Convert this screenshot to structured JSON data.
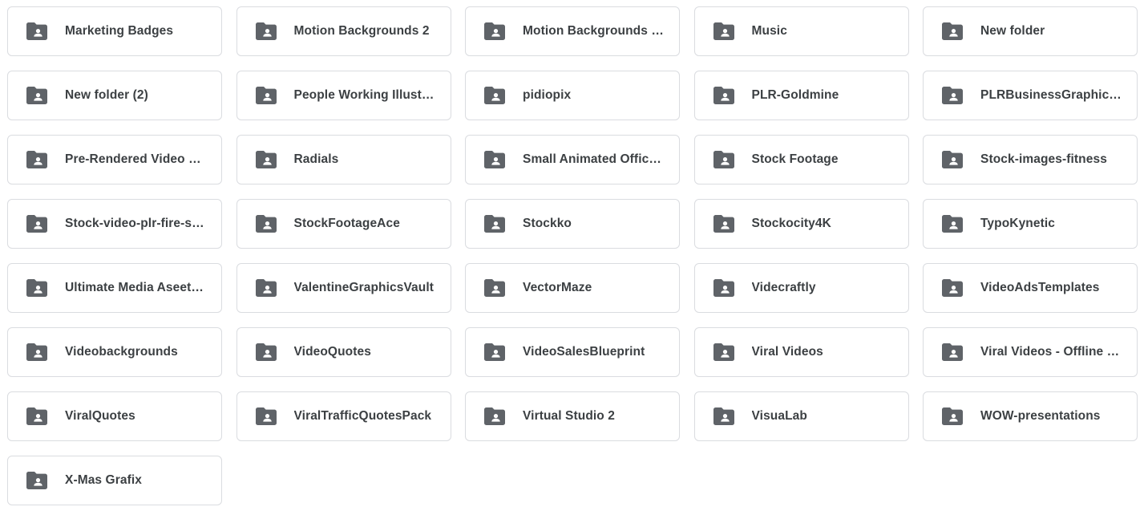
{
  "icon_name": "shared-folder-icon",
  "colors": {
    "icon": "#5f6368",
    "text": "#3c4043",
    "border": "#dadce0",
    "background": "#ffffff"
  },
  "folders": [
    {
      "label": "Marketing Badges"
    },
    {
      "label": "Motion Backgrounds 2"
    },
    {
      "label": "Motion Backgrounds S..."
    },
    {
      "label": "Music"
    },
    {
      "label": "New folder"
    },
    {
      "label": "New folder (2)"
    },
    {
      "label": "People Working Illustra..."
    },
    {
      "label": "pidiopix"
    },
    {
      "label": "PLR-Goldmine"
    },
    {
      "label": "PLRBusinessGraphicT..."
    },
    {
      "label": "Pre-Rendered Video O..."
    },
    {
      "label": "Radials"
    },
    {
      "label": "Small Animated Office ..."
    },
    {
      "label": "Stock Footage"
    },
    {
      "label": "Stock-images-fitness"
    },
    {
      "label": "Stock-video-plr-fire-sal..."
    },
    {
      "label": "StockFootageAce"
    },
    {
      "label": "Stockko"
    },
    {
      "label": "Stockocity4K"
    },
    {
      "label": "TypoKynetic"
    },
    {
      "label": "Ultimate Media Aseets ..."
    },
    {
      "label": "ValentineGraphicsVault"
    },
    {
      "label": "VectorMaze"
    },
    {
      "label": "Videcraftly"
    },
    {
      "label": "VideoAdsTemplates"
    },
    {
      "label": "Videobackgrounds"
    },
    {
      "label": "VideoQuotes"
    },
    {
      "label": "VideoSalesBlueprint"
    },
    {
      "label": "Viral Videos"
    },
    {
      "label": "Viral Videos - Offline B..."
    },
    {
      "label": "ViralQuotes"
    },
    {
      "label": "ViralTrafficQuotesPack"
    },
    {
      "label": "Virtual Studio 2"
    },
    {
      "label": "VisuaLab"
    },
    {
      "label": "WOW-presentations"
    },
    {
      "label": "X-Mas Grafix"
    }
  ]
}
